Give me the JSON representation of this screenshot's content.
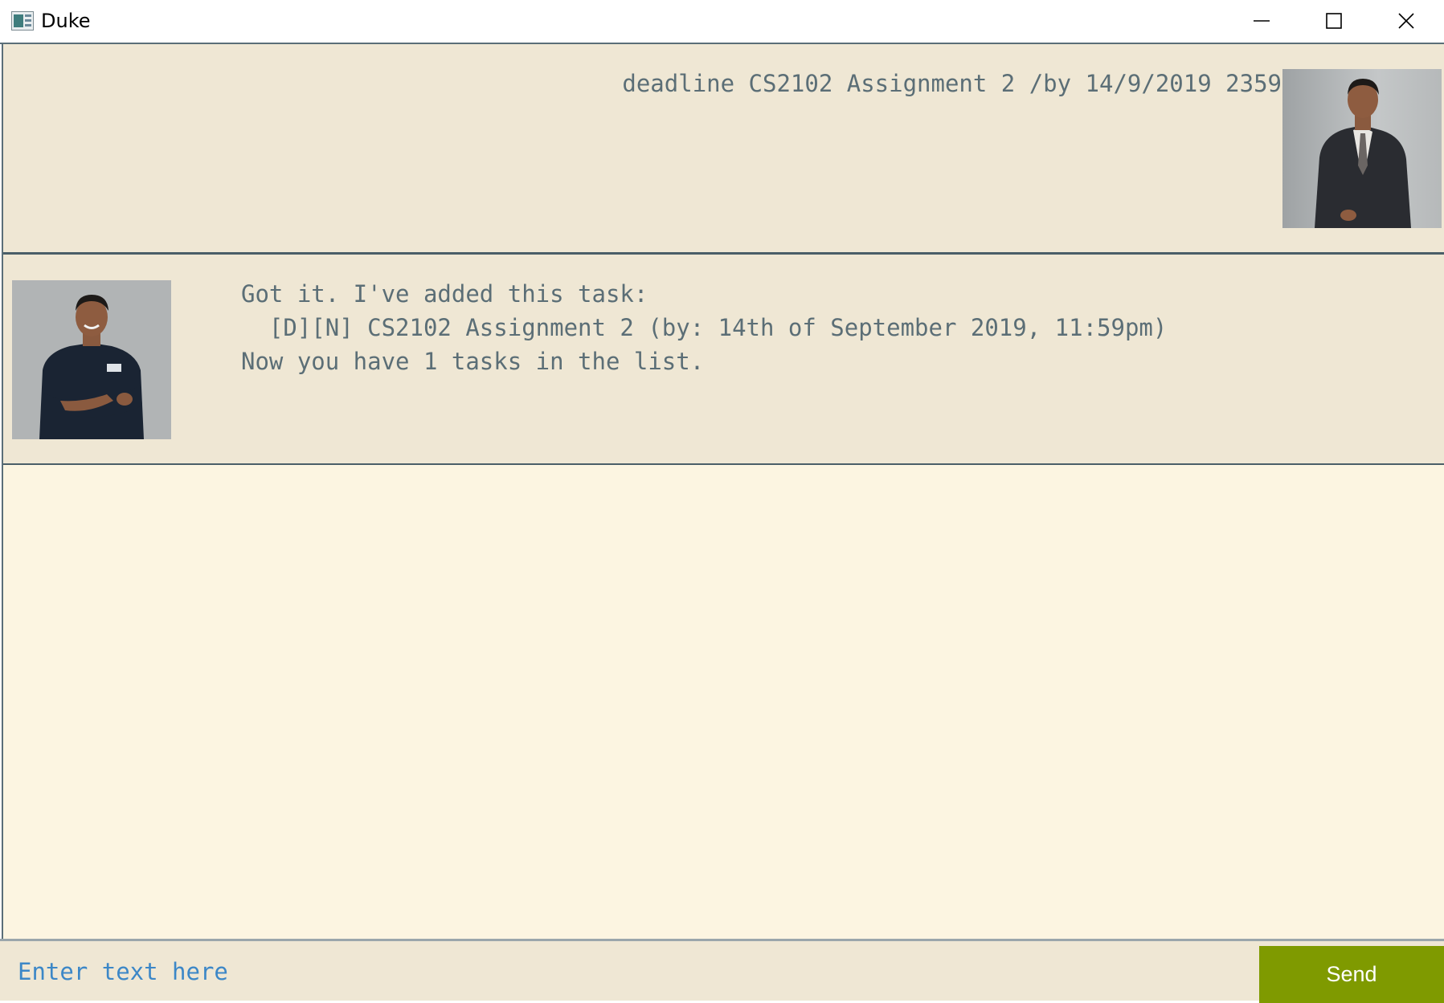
{
  "window": {
    "title": "Duke",
    "controls": [
      "minimize-icon",
      "maximize-icon",
      "close-icon"
    ]
  },
  "dialog": {
    "messages": [
      {
        "sender": "user",
        "text": "deadline CS2102 Assignment 2 /by 14/9/2019 2359"
      },
      {
        "sender": "duke",
        "text": "Got it. I've added this task:\n  [D][N] CS2102 Assignment 2 (by: 14th of September 2019, 11:59pm)\nNow you have 1 tasks in the list."
      }
    ]
  },
  "input": {
    "placeholder": "Enter text here",
    "value": ""
  },
  "send_button": {
    "label": "Send"
  },
  "colors": {
    "dialog_background": "#fcf5e1",
    "bubble_background": "#efe7d4",
    "text": "#5b6e76",
    "input_text": "#3c87c7",
    "send_button": "#7f9a00"
  }
}
